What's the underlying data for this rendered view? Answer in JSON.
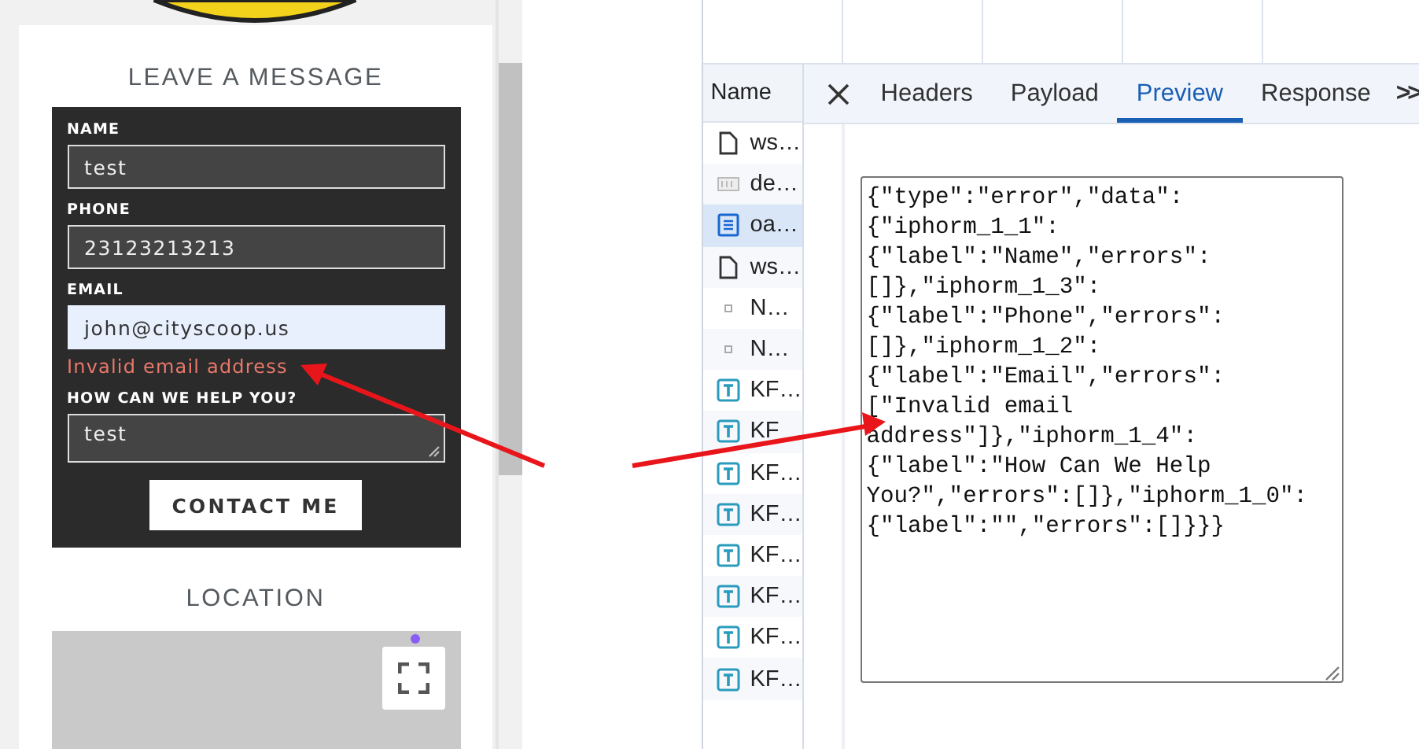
{
  "website": {
    "contact_form": {
      "heading": "LEAVE A MESSAGE",
      "fields": [
        {
          "label": "NAME",
          "value": "test",
          "kind": "text",
          "autofilled": false
        },
        {
          "label": "PHONE",
          "value": "23123213213",
          "kind": "text",
          "autofilled": false
        },
        {
          "label": "EMAIL",
          "value": "john@cityscoop.us",
          "kind": "text",
          "autofilled": true,
          "error": "Invalid email address"
        },
        {
          "label": "HOW CAN WE HELP YOU?",
          "value": "test",
          "kind": "textarea",
          "autofilled": false
        }
      ],
      "submit": "CONTACT ME"
    },
    "location": {
      "heading": "LOCATION"
    }
  },
  "devtools": {
    "name_column": "Name",
    "requests": [
      {
        "name": "ws…",
        "kind": "document",
        "selected": false
      },
      {
        "name": "de…",
        "kind": "image",
        "selected": false
      },
      {
        "name": "oa…",
        "kind": "fetch",
        "selected": true
      },
      {
        "name": "ws…",
        "kind": "document",
        "selected": false
      },
      {
        "name": "N…",
        "kind": "other",
        "selected": false
      },
      {
        "name": "N…",
        "kind": "other",
        "selected": false
      },
      {
        "name": "KF…",
        "kind": "font",
        "selected": false
      },
      {
        "name": "KF",
        "kind": "font",
        "selected": false
      },
      {
        "name": "KF…",
        "kind": "font",
        "selected": false
      },
      {
        "name": "KF…",
        "kind": "font",
        "selected": false
      },
      {
        "name": "KF…",
        "kind": "font",
        "selected": false
      },
      {
        "name": "KF…",
        "kind": "font",
        "selected": false
      },
      {
        "name": "KF…",
        "kind": "font",
        "selected": false
      },
      {
        "name": "KF…",
        "kind": "font",
        "selected": false
      }
    ],
    "tabs": [
      {
        "label": "Headers",
        "selected": false
      },
      {
        "label": "Payload",
        "selected": false
      },
      {
        "label": "Preview",
        "selected": true
      },
      {
        "label": "Response",
        "selected": false
      }
    ],
    "overflow": ">>",
    "preview": "{\"type\":\"error\",\"data\":{\"iphorm_1_1\":{\"label\":\"Name\",\"errors\":[]},\"iphorm_1_3\":{\"label\":\"Phone\",\"errors\":[]},\"iphorm_1_2\":{\"label\":\"Email\",\"errors\":[\"Invalid email address\"]},\"iphorm_1_4\":{\"label\":\"How Can We Help You?\",\"errors\":[]},\"iphorm_1_0\":{\"label\":\"\",\"errors\":[]}}}"
  }
}
